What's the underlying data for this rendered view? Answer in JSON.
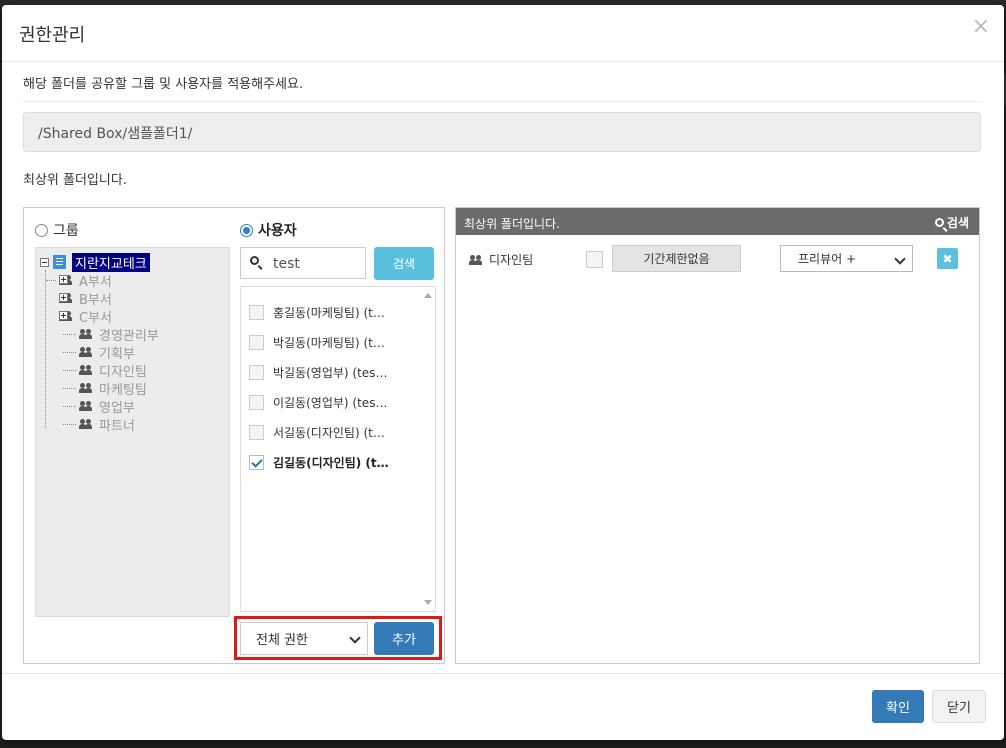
{
  "modal": {
    "title": "권한관리",
    "close_glyph": "×",
    "description": "해당 폴더를 공유할 그룹 및 사용자를 적용해주세요.",
    "path": "/Shared Box/샘플폴더1/",
    "top_folder_label": "최상위 폴더입니다."
  },
  "left_panel": {
    "radio_group_label": "그룹",
    "radio_user_label": "사용자",
    "selected_radio": "사용자",
    "tree": [
      {
        "label": "지란지교테크",
        "icon": "building-icon",
        "level": 0,
        "expander": "minus",
        "selected": true
      },
      {
        "label": "A부서",
        "icon": "people-icon",
        "level": 1,
        "expander": "plus"
      },
      {
        "label": "B부서",
        "icon": "people-icon",
        "level": 1,
        "expander": "plus"
      },
      {
        "label": "C부서",
        "icon": "people-icon",
        "level": 1,
        "expander": "plus"
      },
      {
        "label": "경영관리부",
        "icon": "people-icon",
        "level": 1,
        "expander": "none"
      },
      {
        "label": "기획부",
        "icon": "people-icon",
        "level": 1,
        "expander": "none"
      },
      {
        "label": "디자인팀",
        "icon": "people-icon",
        "level": 1,
        "expander": "none"
      },
      {
        "label": "마케팅팀",
        "icon": "people-icon",
        "level": 1,
        "expander": "none"
      },
      {
        "label": "영업부",
        "icon": "people-icon",
        "level": 1,
        "expander": "none"
      },
      {
        "label": "파트너",
        "icon": "people-icon",
        "level": 1,
        "expander": "none"
      }
    ],
    "search": {
      "value": "test",
      "button_label": "검색"
    },
    "users": [
      {
        "label": "홍길동(마케팅팀) (t…",
        "checked": false
      },
      {
        "label": "박길동(마케팅팀) (t…",
        "checked": false
      },
      {
        "label": "박길동(영업부) (tes…",
        "checked": false
      },
      {
        "label": "이길동(영업부) (tes…",
        "checked": false
      },
      {
        "label": "서길동(디자인팀) (t…",
        "checked": false
      },
      {
        "label": "김길동(디자인팀) (t…",
        "checked": true
      }
    ],
    "permission_select": {
      "selected": "전체 권한"
    },
    "add_button_label": "추가"
  },
  "right_panel": {
    "header_title": "최상위 폴더입니다.",
    "search_label": "검색",
    "rows": [
      {
        "name": "디자인팀",
        "period_label": "기간제한없음",
        "permission": "프리뷰어 +",
        "delete_glyph": "✖"
      }
    ]
  },
  "footer": {
    "ok_label": "확인",
    "close_label": "닫기"
  },
  "colors": {
    "primary": "#337ab7",
    "info": "#5bc0de",
    "highlight_border": "#e01818",
    "tree_selected_bg": "#000080"
  }
}
